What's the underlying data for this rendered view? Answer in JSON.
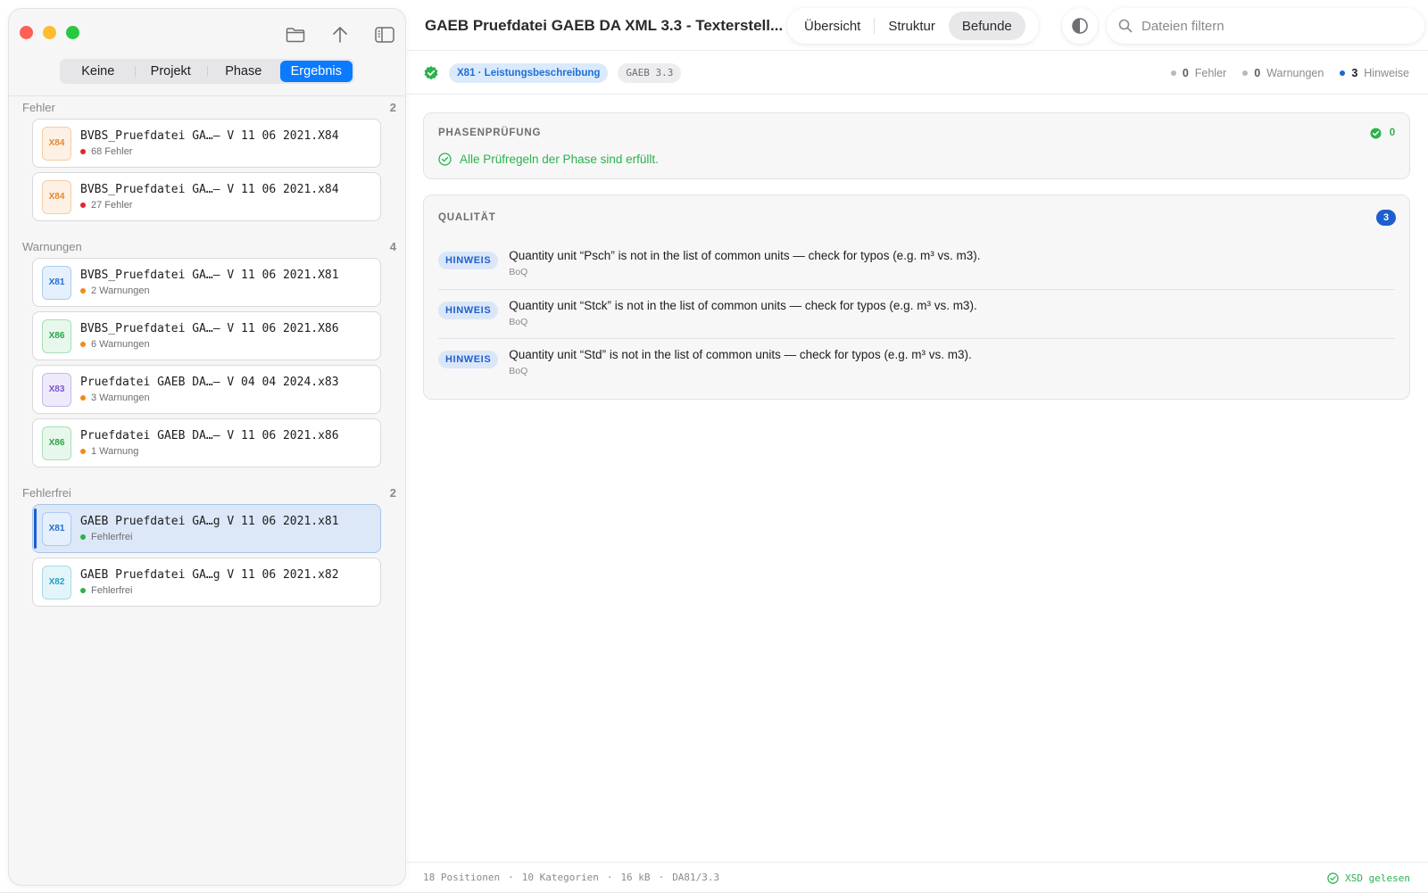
{
  "sidebar": {
    "segments": [
      "Keine",
      "Projekt",
      "Phase",
      "Ergebnis"
    ],
    "active_segment": "Ergebnis",
    "groups": [
      {
        "title": "Fehler",
        "count": "2",
        "items": [
          {
            "badge": "X84",
            "name": "BVBS_Pruefdatei GA…– V 11 06 2021.X84",
            "status": "68 Fehler"
          },
          {
            "badge": "X84",
            "name": "BVBS_Pruefdatei GA…– V 11 06 2021.x84",
            "status": "27 Fehler"
          }
        ]
      },
      {
        "title": "Warnungen",
        "count": "4",
        "items": [
          {
            "badge": "X81",
            "name": "BVBS_Pruefdatei GA…– V 11 06 2021.X81",
            "status": "2 Warnungen"
          },
          {
            "badge": "X86",
            "name": "BVBS_Pruefdatei GA…– V 11 06 2021.X86",
            "status": "6 Warnungen"
          },
          {
            "badge": "X83",
            "name": "Pruefdatei GAEB DA…– V 04 04 2024.x83",
            "status": "3 Warnungen"
          },
          {
            "badge": "X86",
            "name": "Pruefdatei GAEB DA…– V 11 06 2021.x86",
            "status": "1 Warnung"
          }
        ]
      },
      {
        "title": "Fehlerfrei",
        "count": "2",
        "items": [
          {
            "badge": "X81",
            "name": "GAEB Pruefdatei GA…g V 11 06 2021.x81",
            "status": "Fehlerfrei"
          },
          {
            "badge": "X82",
            "name": "GAEB Pruefdatei GA…g V 11 06 2021.x82",
            "status": "Fehlerfrei"
          }
        ]
      }
    ]
  },
  "header": {
    "title": "GAEB Pruefdatei GAEB DA XML 3.3 - Texterstell...",
    "tabs": [
      "Übersicht",
      "Struktur",
      "Befunde"
    ],
    "active_tab": "Befunde",
    "search_placeholder": "Dateien filtern"
  },
  "subbar": {
    "type_pill": "X81 · Leistungsbeschreibung",
    "version_pill": "GAEB 3.3",
    "errors_count": "0",
    "errors_label": "Fehler",
    "warnings_count": "0",
    "warnings_label": "Warnungen",
    "hints_count": "3",
    "hints_label": "Hinweise"
  },
  "phase_panel": {
    "title": "PHASENPRÜFUNG",
    "count": "0",
    "message": "Alle Prüfregeln der Phase sind erfüllt."
  },
  "quality_panel": {
    "title": "QUALITÄT",
    "count": "3",
    "findings": [
      {
        "tag": "HINWEIS",
        "message": "Quantity unit “Psch” is not in the list of common units — check for typos (e.g. m³ vs. m3).",
        "source": "BoQ"
      },
      {
        "tag": "HINWEIS",
        "message": "Quantity unit “Stck” is not in the list of common units — check for typos (e.g. m³ vs. m3).",
        "source": "BoQ"
      },
      {
        "tag": "HINWEIS",
        "message": "Quantity unit “Std” is not in the list of common units — check for typos (e.g. m³ vs. m3).",
        "source": "BoQ"
      }
    ]
  },
  "footer": {
    "positions": "18 Positionen",
    "categories": "10 Kategorien",
    "size": "16 kB",
    "format": "DA81/3.3",
    "separator": "·",
    "xsd_status": "XSD gelesen"
  },
  "colors": {
    "accent": "#0a7aff",
    "error": "#e5232a",
    "warning": "#f08a1a",
    "success": "#2bb24c",
    "hint": "#1e5fcf"
  }
}
